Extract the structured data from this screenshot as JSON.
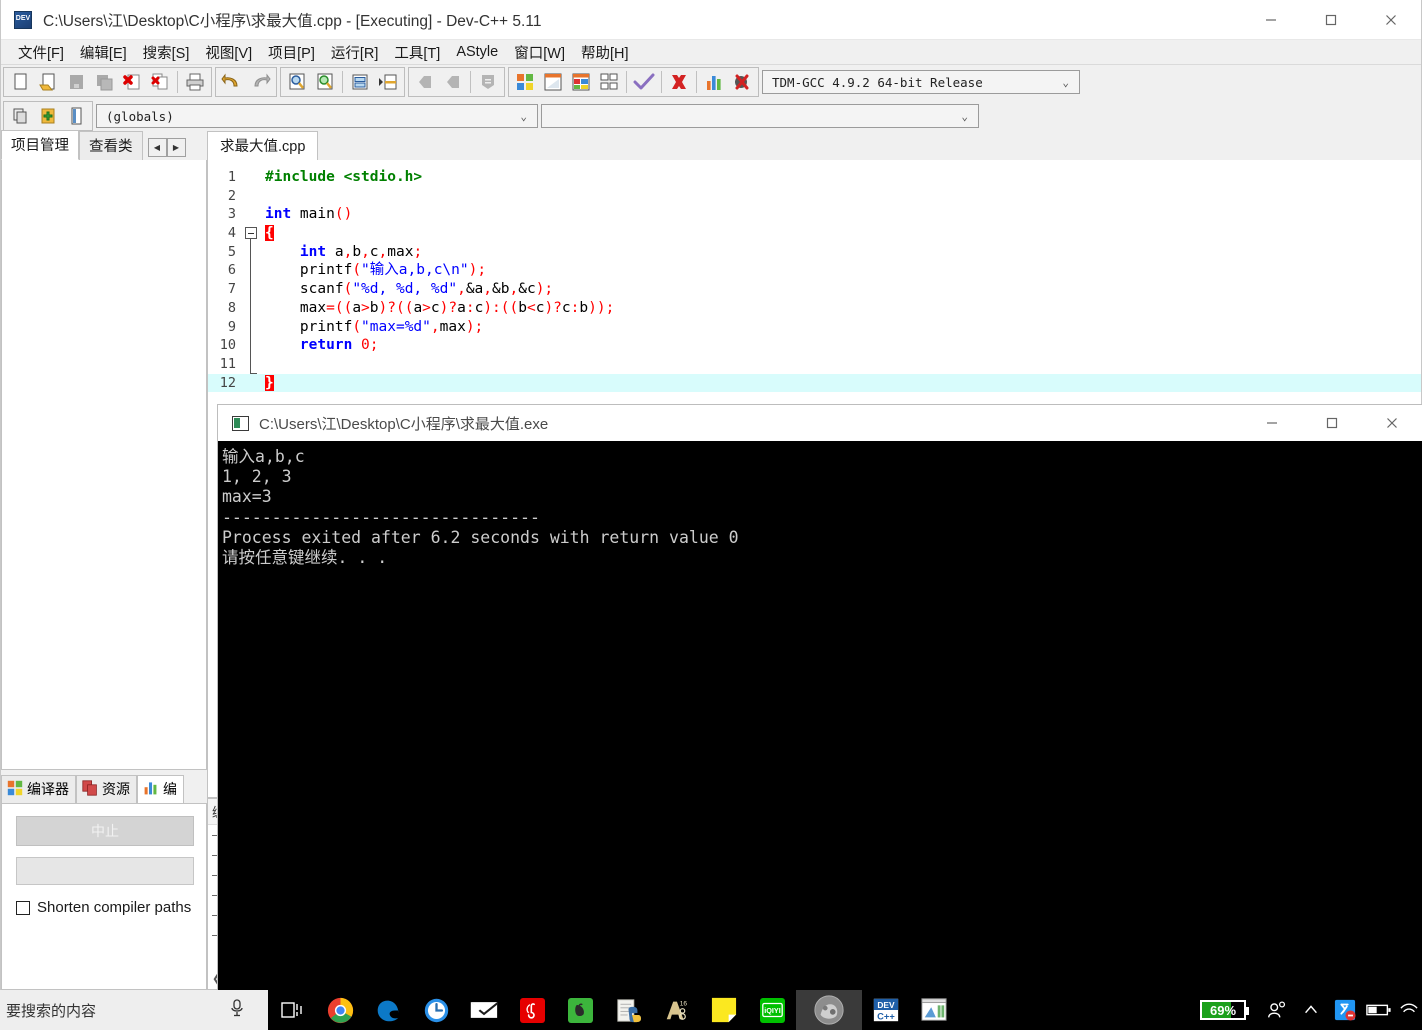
{
  "window": {
    "title": "C:\\Users\\江\\Desktop\\C小程序\\求最大值.cpp - [Executing] - Dev-C++ 5.11",
    "icon": "dev-cpp-icon",
    "controls": {
      "minimize": "—",
      "maximize": "□",
      "close": "✕"
    }
  },
  "menubar": {
    "items": [
      {
        "label": "文件[F]"
      },
      {
        "label": "编辑[E]"
      },
      {
        "label": "搜索[S]"
      },
      {
        "label": "视图[V]"
      },
      {
        "label": "项目[P]"
      },
      {
        "label": "运行[R]"
      },
      {
        "label": "工具[T]"
      },
      {
        "label": "AStyle"
      },
      {
        "label": "窗口[W]"
      },
      {
        "label": "帮助[H]"
      }
    ]
  },
  "toolbar": {
    "groups": [
      {
        "buttons": [
          {
            "name": "new-file-icon"
          },
          {
            "name": "open-file-icon"
          },
          {
            "name": "save-file-icon"
          },
          {
            "name": "save-all-icon"
          },
          {
            "name": "close-file-icon"
          },
          {
            "name": "close-all-icon"
          },
          {
            "sep": true
          },
          {
            "name": "print-icon"
          }
        ]
      },
      {
        "buttons": [
          {
            "name": "undo-icon"
          },
          {
            "name": "redo-icon"
          }
        ]
      },
      {
        "buttons": [
          {
            "name": "find-icon"
          },
          {
            "name": "find-replace-icon"
          },
          {
            "sep": true
          },
          {
            "name": "goto-line-icon"
          },
          {
            "name": "goto-function-icon"
          }
        ]
      },
      {
        "buttons": [
          {
            "name": "back-icon"
          },
          {
            "name": "forward-icon"
          },
          {
            "sep": true
          },
          {
            "name": "bookmark-icon"
          }
        ]
      },
      {
        "buttons": [
          {
            "name": "compile-icon"
          },
          {
            "name": "run-icon"
          },
          {
            "name": "compile-run-icon"
          },
          {
            "name": "rebuild-all-icon"
          },
          {
            "sep": true
          },
          {
            "name": "check-syntax-icon"
          },
          {
            "sep": true
          },
          {
            "name": "stop-execution-icon"
          },
          {
            "sep": true
          },
          {
            "name": "profile-icon"
          },
          {
            "name": "debug-icon"
          }
        ]
      }
    ],
    "compiler_select": {
      "value": "TDM-GCC 4.9.2 64-bit Release",
      "arrow": "⌄"
    }
  },
  "toolbar2": {
    "buttons": [
      {
        "name": "new-project-icon"
      },
      {
        "name": "add-to-project-icon"
      },
      {
        "name": "project-options-icon"
      }
    ],
    "scope_select": {
      "value": "(globals)",
      "arrow": "⌄"
    },
    "symbol_select": {
      "value": "",
      "arrow": "⌄"
    }
  },
  "left_panel": {
    "tabs": [
      {
        "label": "项目管理",
        "active": true
      },
      {
        "label": "查看类",
        "active": false
      }
    ],
    "nav": {
      "prev": "◀",
      "next": "▶"
    }
  },
  "editor": {
    "tab_label": "求最大值.cpp",
    "lines": [
      {
        "num": "1",
        "tokens": [
          {
            "t": "#include <stdio.h>",
            "c": "pp"
          }
        ]
      },
      {
        "num": "2",
        "tokens": []
      },
      {
        "num": "3",
        "tokens": [
          {
            "t": "int",
            "c": "k"
          },
          {
            "t": " main",
            "c": "pl"
          },
          {
            "t": "()",
            "c": "sq"
          }
        ]
      },
      {
        "num": "4",
        "fold": "start",
        "tokens": [
          {
            "t": "{",
            "c": "brace-hl"
          }
        ]
      },
      {
        "num": "5",
        "tokens": [
          {
            "t": "    ",
            "c": "pl"
          },
          {
            "t": "int",
            "c": "k"
          },
          {
            "t": " a",
            "c": "pl"
          },
          {
            "t": ",",
            "c": "sq"
          },
          {
            "t": "b",
            "c": "pl"
          },
          {
            "t": ",",
            "c": "sq"
          },
          {
            "t": "c",
            "c": "pl"
          },
          {
            "t": ",",
            "c": "sq"
          },
          {
            "t": "max",
            "c": "pl"
          },
          {
            "t": ";",
            "c": "sq"
          }
        ]
      },
      {
        "num": "6",
        "tokens": [
          {
            "t": "    printf",
            "c": "pl"
          },
          {
            "t": "(",
            "c": "sq"
          },
          {
            "t": "\"输入a,b,c\\n\"",
            "c": "s"
          },
          {
            "t": ");",
            "c": "sq"
          }
        ]
      },
      {
        "num": "7",
        "tokens": [
          {
            "t": "    scanf",
            "c": "pl"
          },
          {
            "t": "(",
            "c": "sq"
          },
          {
            "t": "\"%d, %d, %d\"",
            "c": "s"
          },
          {
            "t": ",",
            "c": "sq"
          },
          {
            "t": "&a",
            "c": "pl"
          },
          {
            "t": ",",
            "c": "sq"
          },
          {
            "t": "&b",
            "c": "pl"
          },
          {
            "t": ",",
            "c": "sq"
          },
          {
            "t": "&c",
            "c": "pl"
          },
          {
            "t": ");",
            "c": "sq"
          }
        ]
      },
      {
        "num": "8",
        "tokens": [
          {
            "t": "    max",
            "c": "pl"
          },
          {
            "t": "=((",
            "c": "sq"
          },
          {
            "t": "a",
            "c": "pl"
          },
          {
            "t": ">",
            "c": "sq"
          },
          {
            "t": "b",
            "c": "pl"
          },
          {
            "t": ")?((",
            "c": "sq"
          },
          {
            "t": "a",
            "c": "pl"
          },
          {
            "t": ">",
            "c": "sq"
          },
          {
            "t": "c",
            "c": "pl"
          },
          {
            "t": ")?",
            "c": "sq"
          },
          {
            "t": "a",
            "c": "pl"
          },
          {
            "t": ":",
            "c": "sq"
          },
          {
            "t": "c",
            "c": "pl"
          },
          {
            "t": "):((",
            "c": "sq"
          },
          {
            "t": "b",
            "c": "pl"
          },
          {
            "t": "<",
            "c": "sq"
          },
          {
            "t": "c",
            "c": "pl"
          },
          {
            "t": ")?",
            "c": "sq"
          },
          {
            "t": "c",
            "c": "pl"
          },
          {
            "t": ":",
            "c": "sq"
          },
          {
            "t": "b",
            "c": "pl"
          },
          {
            "t": "));",
            "c": "sq"
          }
        ]
      },
      {
        "num": "9",
        "tokens": [
          {
            "t": "    printf",
            "c": "pl"
          },
          {
            "t": "(",
            "c": "sq"
          },
          {
            "t": "\"max=%d\"",
            "c": "s"
          },
          {
            "t": ",",
            "c": "sq"
          },
          {
            "t": "max",
            "c": "pl"
          },
          {
            "t": ");",
            "c": "sq"
          }
        ]
      },
      {
        "num": "10",
        "tokens": [
          {
            "t": "    ",
            "c": "pl"
          },
          {
            "t": "return",
            "c": "k"
          },
          {
            "t": " ",
            "c": "pl"
          },
          {
            "t": "0",
            "c": "n"
          },
          {
            "t": ";",
            "c": "sq"
          }
        ]
      },
      {
        "num": "11",
        "tokens": []
      },
      {
        "num": "12",
        "fold": "end",
        "current": true,
        "tokens": [
          {
            "t": "}",
            "c": "brace-hl"
          }
        ]
      }
    ]
  },
  "bottom_panel": {
    "tabs": [
      {
        "label": "编译器",
        "icon": "compiler-icon",
        "active": false
      },
      {
        "label": "资源",
        "icon": "resource-icon",
        "active": false
      },
      {
        "label": "编",
        "icon": "compile-log-icon",
        "active": true
      }
    ],
    "abort_button": "中止",
    "checkbox_label": "Shorten compiler paths",
    "log_header": "编",
    "log_dashes": [
      "—",
      "—",
      "—",
      "—",
      "—",
      "—"
    ],
    "scroll_left": "❮"
  },
  "console": {
    "title": "C:\\Users\\江\\Desktop\\C小程序\\求最大值.exe",
    "icon": "console-window-icon",
    "controls": {
      "minimize": "—",
      "maximize": "□",
      "close": "✕"
    },
    "output": "输入a,b,c\n1, 2, 3\nmax=3\n--------------------------------\nProcess exited after 6.2 seconds with return value 0\n请按任意键继续. . ."
  },
  "taskbar": {
    "search_placeholder": "要搜索的内容",
    "mic_icon": "microphone-icon",
    "icons": [
      {
        "name": "task-view-icon"
      },
      {
        "name": "chrome-icon"
      },
      {
        "name": "edge-icon"
      },
      {
        "name": "clock-app-icon"
      },
      {
        "name": "mail-icon"
      },
      {
        "name": "netease-music-icon"
      },
      {
        "name": "evernote-icon"
      },
      {
        "name": "python-editor-icon"
      },
      {
        "name": "audition-icon"
      },
      {
        "name": "sticky-notes-icon"
      },
      {
        "name": "iqiyi-icon"
      },
      {
        "name": "photo-viewer-icon"
      },
      {
        "name": "dev-cpp-taskbar-icon"
      },
      {
        "name": "console-taskbar-icon"
      }
    ],
    "tray": {
      "battery_percent": "69%",
      "chevron_up_icon": "chevron-up-icon",
      "people_icon": "people-icon",
      "action-center": "action-center-icon",
      "battery_icon": "battery-icon",
      "network_icon": "network-icon"
    }
  },
  "colors": {
    "accent_blue": "#0000ff",
    "string_blue": "#0000ff",
    "preproc_green": "#008000",
    "punct_red": "#ff0000",
    "current_line": "#d8fcfc",
    "battery_green": "#1ca01c"
  }
}
